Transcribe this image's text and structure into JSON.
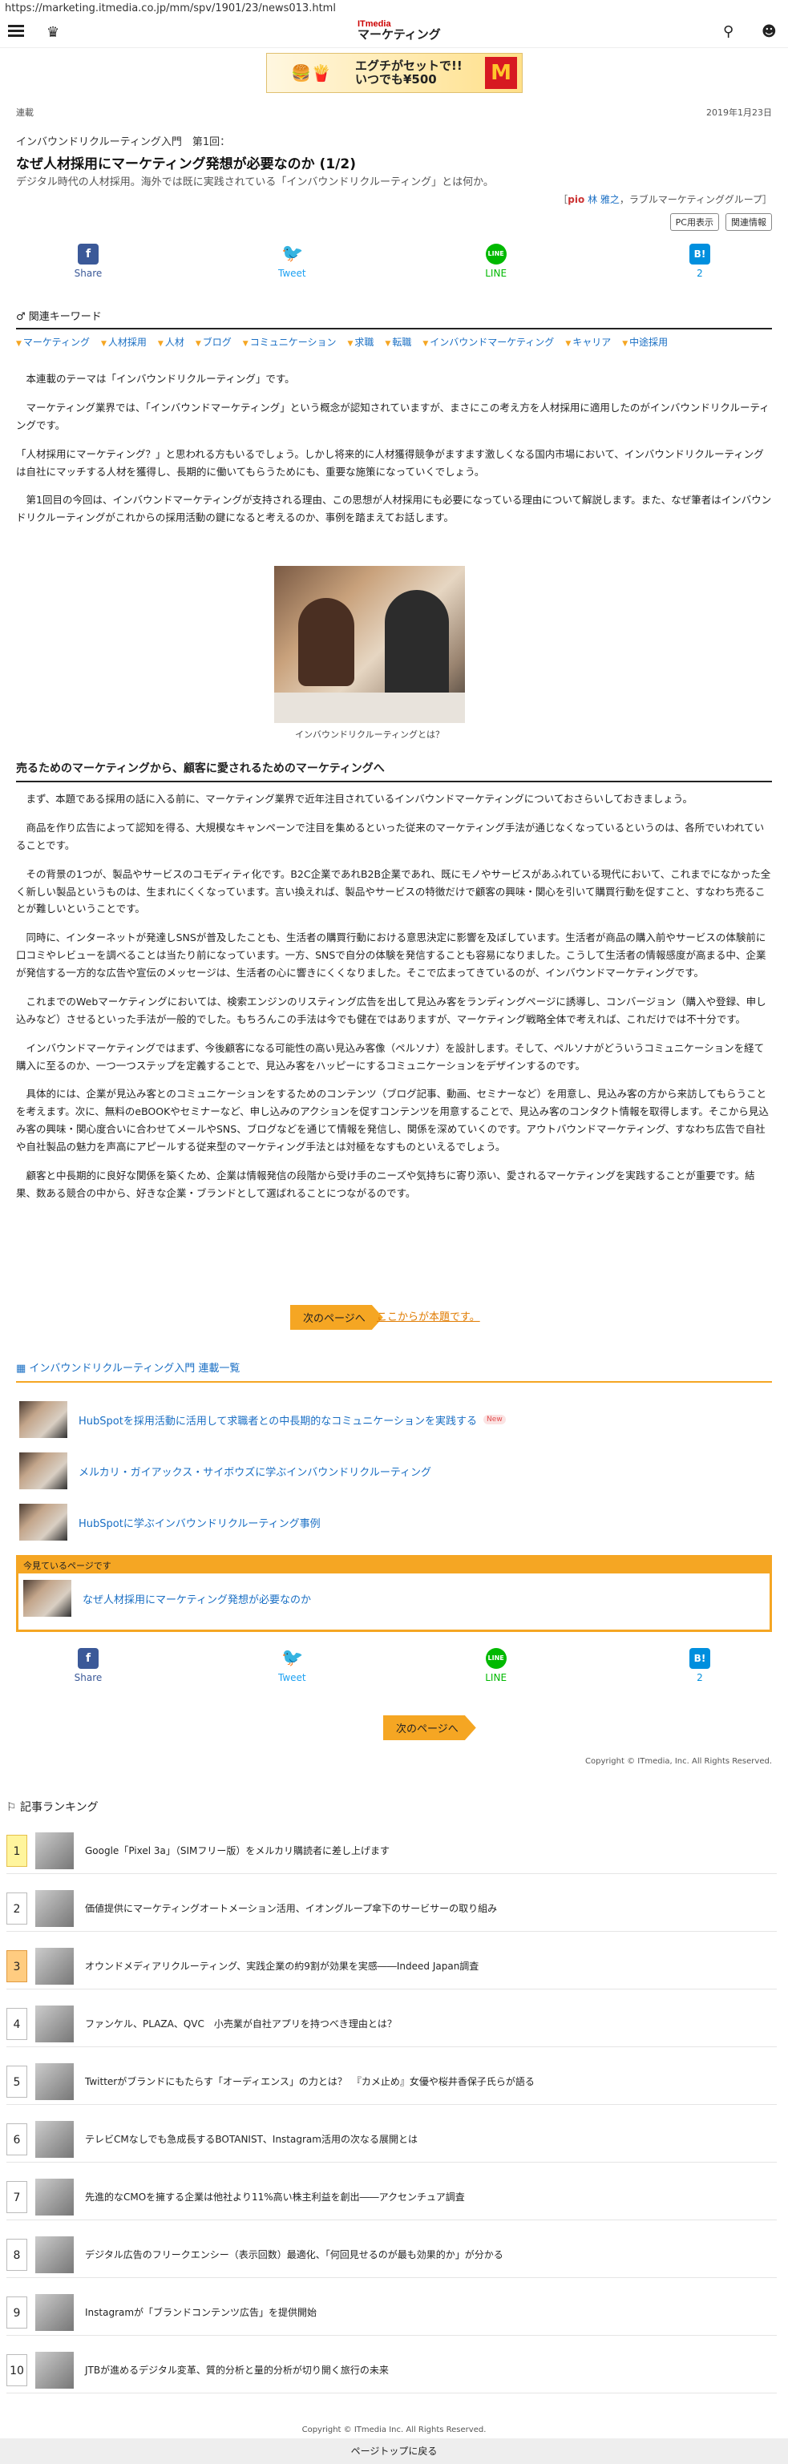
{
  "browser": {
    "url": "https://marketing.itmedia.co.jp/mm/spv/1901/23/news013.html"
  },
  "header": {
    "logo_top": "ITmedia",
    "logo_bottom": "マーケティング",
    "menu_icon": "hamburger-icon",
    "crown_icon": "crown-icon",
    "search_icon": "search-icon",
    "user_icon": "user-icon"
  },
  "ad": {
    "text1": "エグチがセットで!!",
    "text2": "いつでも¥500",
    "mark": "M"
  },
  "meta": {
    "category": "連載",
    "date": "2019年1月23日"
  },
  "article": {
    "series": "インバウンドリクルーティング入門　第1回：",
    "title": "なぜ人材採用にマーケティング発想が必要なのか (1/2)",
    "lead": "デジタル時代の人材採用。海外では既に実践されている「インバウンドリクルーティング」とは何か。",
    "author_prefix": "［",
    "author_pr": "pio",
    "author_name": "林 雅之",
    "author_suffix": "，ラブルマーケティンググループ］",
    "pc_button": "PC用表示",
    "related_button": "関連情報"
  },
  "share": {
    "facebook": "Share",
    "twitter": "Tweet",
    "line": "LINE",
    "hatena": "2"
  },
  "keywords": {
    "head": "関連キーワード",
    "items": [
      "マーケティング",
      "人材採用",
      "人材",
      "ブログ",
      "コミュニケーション",
      "求職",
      "転職",
      "インバウンドマーケティング",
      "キャリア",
      "中途採用"
    ]
  },
  "intro": [
    "　本連載のテーマは「インバウンドリクルーティング」です。",
    "　マーケティング業界では、「インバウンドマーケティング」という概念が認知されていますが、まさにこの考え方を人材採用に適用したのがインバウンドリクルーティングです。",
    "「人材採用にマーケティング？」と思われる方もいるでしょう。しかし将来的に人材獲得競争がますます激しくなる国内市場において、インバウンドリクルーティングは自社にマッチする人材を獲得し、長期的に働いてもらうためにも、重要な施策になっていくでしょう。",
    "　第1回目の今回は、インバウンドマーケティングが支持される理由、この思想が人材採用にも必要になっている理由について解説します。また、なぜ筆者はインバウンドリクルーティングがこれからの採用活動の鍵になると考えるのか、事例を踏まえてお話します。"
  ],
  "figure": {
    "caption": "インバウンドリクルーティングとは？"
  },
  "section": {
    "heading": "売るためのマーケティングから、顧客に愛されるためのマーケティングへ",
    "paragraphs": [
      "　まず、本題である採用の話に入る前に、マーケティング業界で近年注目されているインバウンドマーケティングについておさらいしておきましょう。",
      "　商品を作り広告によって認知を得る、大規模なキャンペーンで注目を集めるといった従来のマーケティング手法が通じなくなっているというのは、各所でいわれていることです。",
      "　その背景の1つが、製品やサービスのコモディティ化です。B2C企業であれB2B企業であれ、既にモノやサービスがあふれている現代において、これまでになかった全く新しい製品というものは、生まれにくくなっています。言い換えれば、製品やサービスの特徴だけで顧客の興味・関心を引いて購買行動を促すこと、すなわち売ることが難しいということです。",
      "　同時に、インターネットが発達しSNSが普及したことも、生活者の購買行動における意思決定に影響を及ぼしています。生活者が商品の購入前やサービスの体験前に口コミやレビューを調べることは当たり前になっています。一方、SNSで自分の体験を発信することも容易になりました。こうして生活者の情報感度が高まる中、企業が発信する一方的な広告や宣伝のメッセージは、生活者の心に響きにくくなりました。そこで広まってきているのが、インバウンドマーケティングです。",
      "　これまでのWebマーケティングにおいては、検索エンジンのリスティング広告を出して見込み客をランディングページに誘導し、コンバージョン（購入や登録、申し込みなど）させるといった手法が一般的でした。もちろんこの手法は今でも健在ではありますが、マーケティング戦略全体で考えれば、これだけでは不十分です。",
      "　インバウンドマーケティングではまず、今後顧客になる可能性の高い見込み客像（ペルソナ）を設計します。そして、ペルソナがどういうコミュニケーションを経て購入に至るのか、一つ一つステップを定義することで、見込み客をハッピーにするコミュニケーションをデザインするのです。",
      "　具体的には、企業が見込み客とのコミュニケーションをするためのコンテンツ（ブログ記事、動画、セミナーなど）を用意し、見込み客の方から来訪してもらうことを考えます。次に、無料のeBOOKやセミナーなど、申し込みのアクションを促すコンテンツを用意することで、見込み客のコンタクト情報を取得します。そこから見込み客の興味・関心度合いに合わせてメールやSNS、ブログなどを通じて情報を発信し、関係を深めていくのです。アウトバウンドマーケティング、すなわち広告で自社や自社製品の魅力を声高にアピールする従来型のマーケティング手法とは対極をなすものといえるでしょう。",
      "　顧客と中長期的に良好な関係を築くため、企業は情報発信の段階から受け手のニーズや気持ちに寄り添い、愛されるマーケティングを実践することが重要です。結果、数ある競合の中から、好きな企業・ブランドとして選ばれることにつながるのです。"
    ]
  },
  "next": {
    "button": "次のページへ",
    "link": "ここからが本題です。"
  },
  "series_list": {
    "head": "インバウンドリクルーティング入門 連載一覧",
    "items": [
      {
        "title": "HubSpotを採用活動に活用して求職者との中長期的なコミュニケーションを実践する",
        "badge": "New"
      },
      {
        "title": "メルカリ・ガイアックス・サイボウズに学ぶインバウンドリクルーティング",
        "badge": ""
      },
      {
        "title": "HubSpotに学ぶインバウンドリクルーティング事例",
        "badge": ""
      }
    ],
    "current_label": "今見ているページです",
    "current_title": "なぜ人材採用にマーケティング発想が必要なのか"
  },
  "copyright_article": "Copyright © ITmedia, Inc. All Rights Reserved.",
  "ranking": {
    "head": "記事ランキング",
    "items": [
      {
        "num": "1",
        "title": "Google「Pixel 3a」（SIMフリー版）をメルカリ購読者に差し上げます"
      },
      {
        "num": "2",
        "title": "価値提供にマーケティングオートメーション活用、イオングループ傘下のサービサーの取り組み"
      },
      {
        "num": "3",
        "title": "オウンドメディアリクルーティング、実践企業の約9割が効果を実感――Indeed Japan調査"
      },
      {
        "num": "4",
        "title": "ファンケル、PLAZA、QVC　小売業が自社アプリを持つべき理由とは？"
      },
      {
        "num": "5",
        "title": "Twitterがブランドにもたらす「オーディエンス」の力とは？　『カメ止め』女優や桜井香保子氏らが語る"
      },
      {
        "num": "6",
        "title": "テレビCMなしでも急成長するBOTANIST、Instagram活用の次なる展開とは"
      },
      {
        "num": "7",
        "title": "先進的なCMOを擁する企業は他社より11%高い株主利益を創出――アクセンチュア調査"
      },
      {
        "num": "8",
        "title": "デジタル広告のフリークエンシー（表示回数）最適化、「何回見せるのが最も効果的か」が分かる"
      },
      {
        "num": "9",
        "title": "Instagramが「ブランドコンテンツ広告」を提供開始"
      },
      {
        "num": "10",
        "title": "JTBが進めるデジタル変革、質的分析と量的分析が切り開く旅行の未来"
      }
    ]
  },
  "footer": {
    "copyright": "Copyright © ITmedia Inc. All Rights Reserved.",
    "pagetop": "ページトップに戻る"
  }
}
